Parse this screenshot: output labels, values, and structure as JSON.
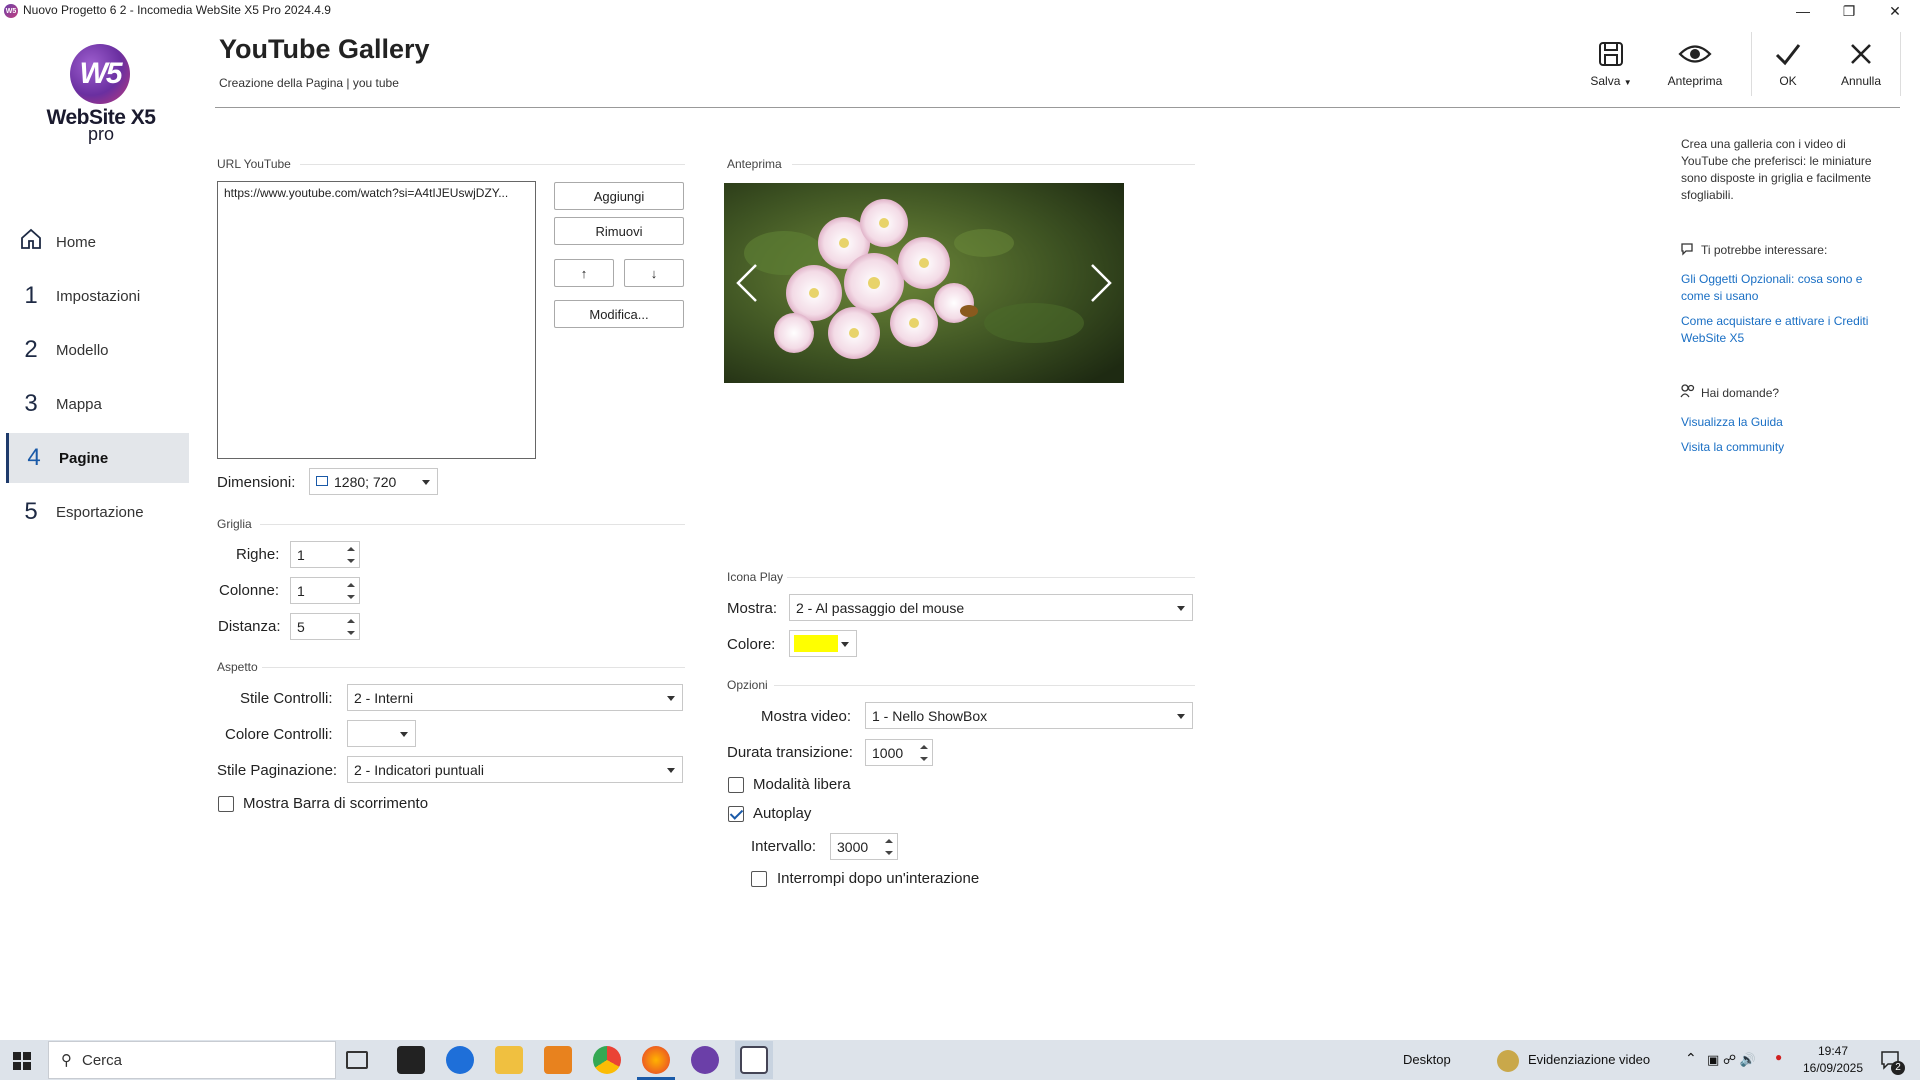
{
  "window": {
    "title": "Nuovo Progetto 6 2 - Incomedia WebSite X5 Pro 2024.4.9",
    "logo_badge": "W5",
    "logo_name": "WebSite X5",
    "logo_sub": "pro"
  },
  "sidebar": {
    "items": [
      {
        "num": "",
        "label": "Home",
        "icon": "home-icon"
      },
      {
        "num": "1",
        "label": "Impostazioni"
      },
      {
        "num": "2",
        "label": "Modello"
      },
      {
        "num": "3",
        "label": "Mappa"
      },
      {
        "num": "4",
        "label": "Pagine",
        "active": true
      },
      {
        "num": "5",
        "label": "Esportazione"
      }
    ]
  },
  "header": {
    "title": "YouTube Gallery",
    "breadcrumb": "Creazione della Pagina | you tube"
  },
  "toolbar": {
    "save": "Salva",
    "preview": "Anteprima",
    "ok": "OK",
    "cancel": "Annulla"
  },
  "url_section": {
    "label": "URL YouTube",
    "items": [
      "https://www.youtube.com/watch?si=A4tIJEUswjDZY..."
    ],
    "add": "Aggiungi",
    "remove": "Rimuovi",
    "up": "↑",
    "down": "↓",
    "edit": "Modifica..."
  },
  "dimensions": {
    "label": "Dimensioni:",
    "value": "1280; 720"
  },
  "grid": {
    "label": "Griglia",
    "rows_label": "Righe:",
    "rows": "1",
    "cols_label": "Colonne:",
    "cols": "1",
    "dist_label": "Distanza:",
    "dist": "5"
  },
  "appearance": {
    "label": "Aspetto",
    "ctrl_style_label": "Stile Controlli:",
    "ctrl_style": "2 - Interni",
    "ctrl_color_label": "Colore Controlli:",
    "page_style_label": "Stile Paginazione:",
    "page_style": "2 - Indicatori puntuali",
    "scrollbar_label": "Mostra Barra di scorrimento"
  },
  "preview_section": {
    "label": "Anteprima"
  },
  "play_icon": {
    "label": "Icona Play",
    "show_label": "Mostra:",
    "show": "2 - Al passaggio del mouse",
    "color_label": "Colore:",
    "color": "#ffff00"
  },
  "options": {
    "label": "Opzioni",
    "show_video_label": "Mostra video:",
    "show_video": "1 - Nello ShowBox",
    "transition_label": "Durata transizione:",
    "transition": "1000",
    "free_mode_label": "Modalità libera",
    "autoplay_label": "Autoplay",
    "interval_label": "Intervallo:",
    "interval": "3000",
    "stop_label": "Interrompi dopo un'interazione"
  },
  "info_panel": {
    "description": "Crea una galleria con i video di YouTube che preferisci: le miniature sono disposte in griglia e facilmente sfogliabili.",
    "interest_title": "Ti potrebbe interessare:",
    "link1": "Gli Oggetti Opzionali: cosa sono e come si usano",
    "link2": "Come acquistare e attivare i Crediti WebSite X5",
    "questions_title": "Hai domande?",
    "link3": "Visualizza la Guida",
    "link4": "Visita la community"
  },
  "taskbar": {
    "search_placeholder": "Cerca",
    "desktop": "Desktop",
    "notification": "Evidenziazione video",
    "time": "19:47",
    "date": "16/09/2025",
    "badge": "2"
  },
  "colors": {
    "accent": "#1a5aa8",
    "link": "#1a6fc4"
  }
}
